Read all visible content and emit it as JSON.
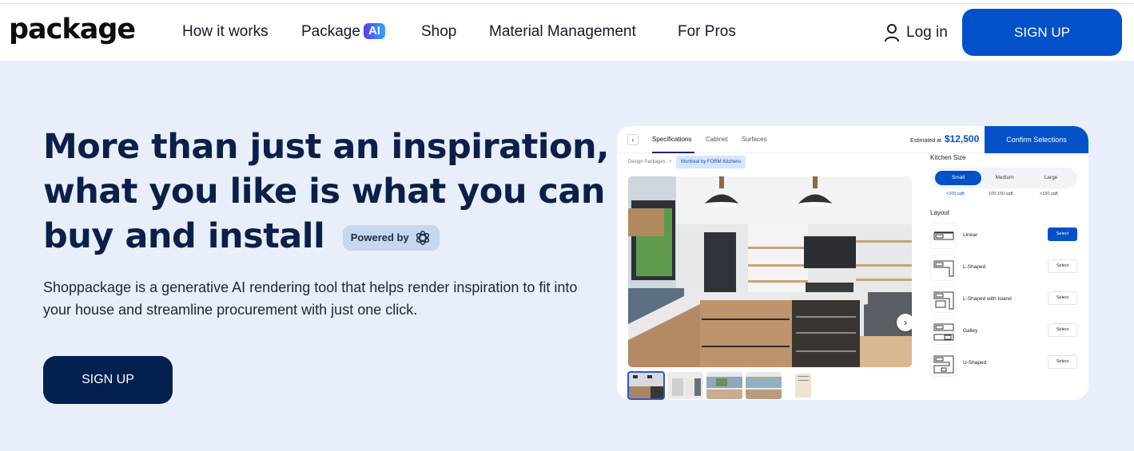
{
  "header": {
    "logo": "package",
    "nav": [
      {
        "label": "How it works"
      },
      {
        "label": "Package",
        "badge": "AI"
      },
      {
        "label": "Shop"
      },
      {
        "label": "Material Management"
      },
      {
        "label": "For Pros"
      }
    ],
    "login_label": "Log in",
    "signup_label": "SIGN UP"
  },
  "hero": {
    "headline_lines": [
      "More than just an inspiration,",
      "what you like is what you can",
      "buy and install"
    ],
    "powered_by": "Powered by",
    "powered_icon": "openai-logo-icon",
    "description": "Shoppackage is a generative AI rendering tool that helps render inspiration to fit into your house and streamline procurement with just one click.",
    "signup_label": "SIGN UP"
  },
  "mock": {
    "tabs": [
      "Specifications",
      "Cabinet",
      "Surfaces"
    ],
    "active_tab": "Specifications",
    "estimate_label": "Estimated at",
    "estimate_value": "$12,500",
    "confirm_label": "Confirm Selections",
    "breadcrumb": [
      "Design Packages",
      "Montreal by FORM Kitchens"
    ],
    "breadcrumb_sep": ">",
    "next_icon": "chevron-right-icon",
    "kitchen_size": {
      "title": "Kitchen Size",
      "options": [
        {
          "label": "Small",
          "sub": "<100 sqft.",
          "selected": true
        },
        {
          "label": "Medium",
          "sub": "100-150 sqft.",
          "selected": false
        },
        {
          "label": "Large",
          "sub": ">150 sqft.",
          "selected": false
        }
      ]
    },
    "layout": {
      "title": "Layout",
      "select_label": "Select",
      "items": [
        {
          "label": "Linear",
          "selected": true
        },
        {
          "label": "L-Shaped",
          "selected": false
        },
        {
          "label": "L-Shaped with Island",
          "selected": false
        },
        {
          "label": "Galley",
          "selected": false
        },
        {
          "label": "U-Shaped",
          "selected": false
        }
      ]
    },
    "thumbnail_count": 5,
    "selected_thumbnail": 1
  }
}
